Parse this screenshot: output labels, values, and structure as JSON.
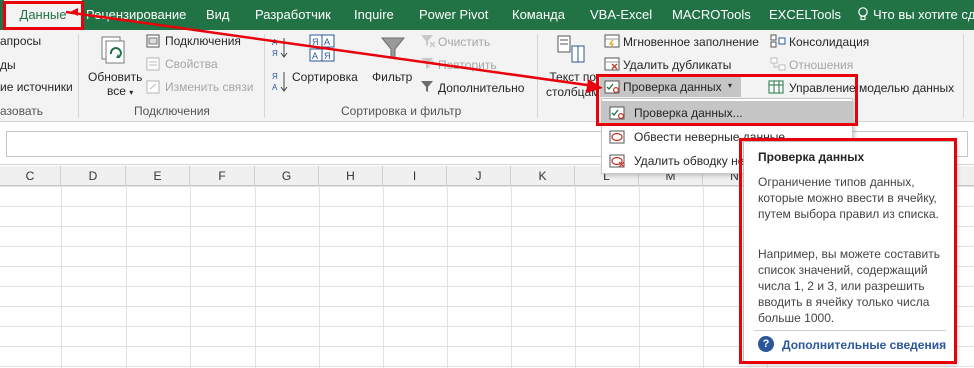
{
  "tabs": [
    {
      "label": "Данные",
      "active": true
    },
    {
      "label": "Рецензирование"
    },
    {
      "label": "Вид"
    },
    {
      "label": "Разработчик"
    },
    {
      "label": "Inquire"
    },
    {
      "label": "Power Pivot"
    },
    {
      "label": "Команда"
    },
    {
      "label": "VBA-Excel"
    },
    {
      "label": "MACROTools"
    },
    {
      "label": "EXCELTools"
    }
  ],
  "tell_me": "Что вы хотите сде",
  "ribbon": {
    "get_group": {
      "queries": "апросы",
      "items": "ды",
      "recent_sources": "ие источники",
      "label": "азовать"
    },
    "connections_group": {
      "refresh_all_line1": "Обновить",
      "refresh_all_line2": "все",
      "connections": "Подключения",
      "properties": "Свойства",
      "edit_links": "Изменить связи",
      "label": "Подключения"
    },
    "sort_filter_group": {
      "sort": "Сортировка",
      "filter": "Фильтр",
      "clear": "Очистить",
      "reapply": "Повторить",
      "advanced": "Дополнительно",
      "label": "Сортировка и фильтр"
    },
    "data_tools_group": {
      "text_to_columns_line1": "Текст по",
      "text_to_columns_line2": "столбцам",
      "flash_fill": "Мгновенное заполнение",
      "remove_duplicates": "Удалить дубликаты",
      "data_validation": "Проверка данных",
      "consolidate": "Консолидация",
      "relationships": "Отношения",
      "manage_data_model": "Управление моделью данных"
    }
  },
  "dropdown": {
    "items": [
      {
        "label": "Проверка данных..."
      },
      {
        "label": "Обвести неверные данные"
      },
      {
        "label": "Удалить обводку неверных данных"
      }
    ]
  },
  "columns": [
    "C",
    "D",
    "E",
    "F",
    "G",
    "H",
    "I",
    "J",
    "K",
    "L",
    "M",
    "N"
  ],
  "tooltip": {
    "title": "Проверка данных",
    "paragraph1": "Ограничение типов данных, которые можно ввести в ячейку, путем выбора правил из списка.",
    "paragraph2": "Например, вы можете составить список значений, содержащий числа 1, 2 и 3, или разрешить вводить в ячейку только числа больше 1000.",
    "link": "Дополнительные сведения"
  },
  "colors": {
    "excel_green": "#217346",
    "annotation_red": "#e8000b",
    "link_blue": "#2b579a"
  }
}
